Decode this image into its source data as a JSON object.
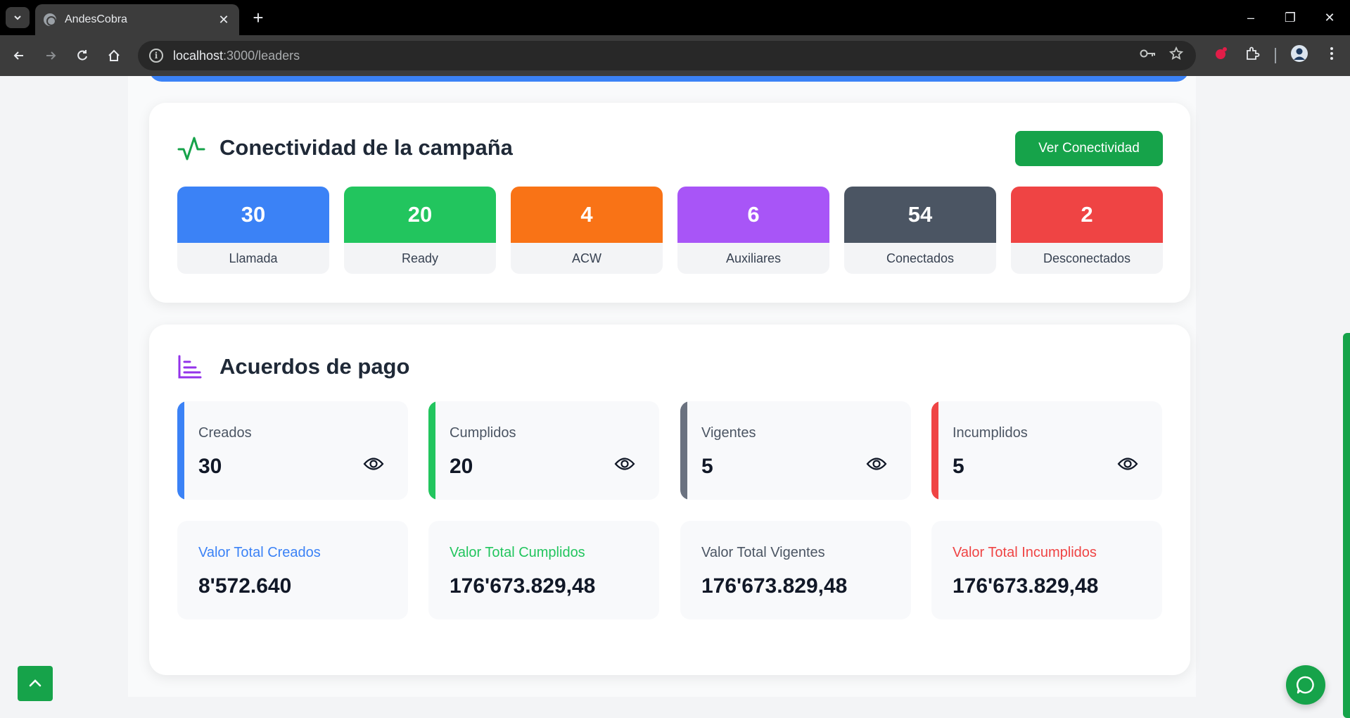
{
  "browser": {
    "tab_title": "AndesCobra",
    "url_host": "localhost",
    "url_rest": ":3000/leaders"
  },
  "connectivity": {
    "title": "Conectividad de la campaña",
    "button_label": "Ver Conectividad",
    "stats": [
      {
        "value": "30",
        "label": "Llamada",
        "color": "#3b82f6"
      },
      {
        "value": "20",
        "label": "Ready",
        "color": "#22c55e"
      },
      {
        "value": "4",
        "label": "ACW",
        "color": "#f97316"
      },
      {
        "value": "6",
        "label": "Auxiliares",
        "color": "#a855f7"
      },
      {
        "value": "54",
        "label": "Conectados",
        "color": "#4b5563"
      },
      {
        "value": "2",
        "label": "Desconectados",
        "color": "#ef4444"
      }
    ]
  },
  "agreements": {
    "title": "Acuerdos de pago",
    "counts": [
      {
        "label": "Creados",
        "value": "30",
        "color": "#3b82f6"
      },
      {
        "label": "Cumplidos",
        "value": "20",
        "color": "#22c55e"
      },
      {
        "label": "Vigentes",
        "value": "5",
        "color": "#6b7280"
      },
      {
        "label": "Incumplidos",
        "value": "5",
        "color": "#ef4444"
      }
    ],
    "totals": [
      {
        "label": "Valor Total Creados",
        "value": "8'572.640",
        "color": "#3b82f6"
      },
      {
        "label": "Valor Total Cumplidos",
        "value": "176'673.829,48",
        "color": "#22c55e"
      },
      {
        "label": "Valor Total Vigentes",
        "value": "176'673.829,48",
        "color": "#4b5563"
      },
      {
        "label": "Valor Total Incumplidos",
        "value": "176'673.829,48",
        "color": "#ef4444"
      }
    ]
  }
}
